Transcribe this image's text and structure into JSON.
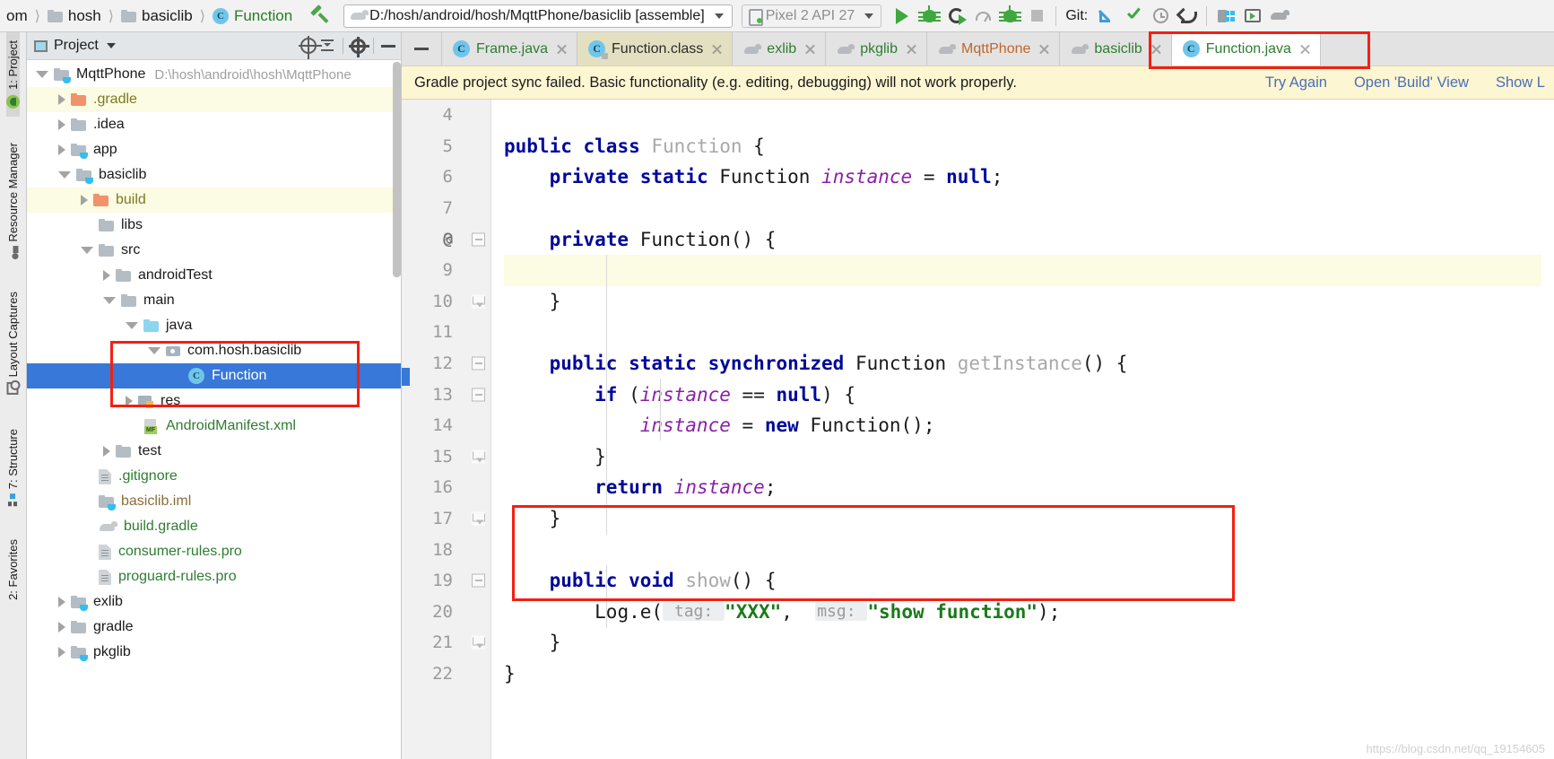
{
  "toolbar": {
    "breadcrumbs": [
      {
        "label": "om",
        "icon": "none",
        "color": "dark"
      },
      {
        "label": "hosh",
        "icon": "folder-icon",
        "color": "dark"
      },
      {
        "label": "basiclib",
        "icon": "folder-icon",
        "color": "dark"
      },
      {
        "label": "Function",
        "icon": "class-icon",
        "color": "green"
      }
    ],
    "build_icon": "hammer-icon",
    "run_config": {
      "icon": "gradle-icon",
      "value": "D:/hosh/android/hosh/MqttPhone/basiclib [assemble]",
      "dropdown_icon": "chevron-down-icon"
    },
    "device": {
      "icon": "device-icon",
      "value": "Pixel 2 API 27",
      "dropdown_icon": "chevron-down-icon"
    },
    "actions": [
      {
        "name": "run-button",
        "icon": "play-icon"
      },
      {
        "name": "debug-button",
        "icon": "bug-icon"
      },
      {
        "name": "run-coverage-button",
        "icon": "coverage-icon"
      },
      {
        "name": "profile-button",
        "icon": "gauge-icon"
      },
      {
        "name": "attach-debugger-button",
        "icon": "attach-debugger-icon"
      },
      {
        "name": "stop-button",
        "icon": "stop-icon"
      }
    ],
    "git_label": "Git:",
    "git_actions": [
      {
        "name": "update-project-button",
        "icon": "update-arrow-icon"
      },
      {
        "name": "commit-button",
        "icon": "check-icon"
      },
      {
        "name": "history-button",
        "icon": "clock-icon"
      },
      {
        "name": "rollback-button",
        "icon": "revert-icon"
      }
    ],
    "right_actions": [
      {
        "name": "project-structure-button",
        "icon": "project-structure-icon"
      },
      {
        "name": "avd-manager-button",
        "icon": "avd-manager-icon"
      },
      {
        "name": "sdk-manager-button",
        "icon": "sdk-manager-icon"
      }
    ]
  },
  "left_strip": {
    "tabs": [
      {
        "label": "1: Project",
        "icon": "android-icon",
        "active": true
      },
      {
        "label": "Resource Manager",
        "icon": "resource-icon",
        "active": false
      },
      {
        "label": "Layout Captures",
        "icon": "capture-icon",
        "active": false
      },
      {
        "label": "7: Structure",
        "icon": "structure-icon",
        "active": false
      },
      {
        "label": "2: Favorites",
        "icon": "favorites-icon",
        "active": false
      }
    ]
  },
  "project_panel": {
    "title": "Project",
    "window_icon": "project-window-icon",
    "dropdown_icon": "chevron-down-icon",
    "actions": [
      {
        "name": "scroll-from-source-button",
        "icon": "target-icon"
      },
      {
        "name": "collapse-all-button",
        "icon": "collapse-all-icon"
      },
      {
        "name": "settings-button",
        "icon": "gear-icon"
      },
      {
        "name": "hide-button",
        "icon": "minimize-icon"
      }
    ],
    "tree": [
      {
        "label": "MqttPhone",
        "hint": "D:\\hosh\\android\\hosh\\MqttPhone",
        "indent": 0,
        "arrow": "down",
        "icon": "module-folder-icon",
        "color": "dark",
        "state": "normal"
      },
      {
        "label": ".gradle",
        "hint": "",
        "indent": 1,
        "arrow": "right",
        "icon": "orange-folder-icon",
        "color": "olive",
        "state": "yellow"
      },
      {
        "label": ".idea",
        "hint": "",
        "indent": 1,
        "arrow": "right",
        "icon": "grey-folder-icon",
        "color": "dark",
        "state": "normal"
      },
      {
        "label": "app",
        "hint": "",
        "indent": 1,
        "arrow": "right",
        "icon": "module-folder-icon",
        "color": "dark",
        "state": "normal"
      },
      {
        "label": "basiclib",
        "hint": "",
        "indent": 1,
        "arrow": "down",
        "icon": "module-folder-icon",
        "color": "dark",
        "state": "normal"
      },
      {
        "label": "build",
        "hint": "",
        "indent": 2,
        "arrow": "right",
        "icon": "orange-folder-icon",
        "color": "olive",
        "state": "yellow"
      },
      {
        "label": "libs",
        "hint": "",
        "indent": 2,
        "arrow": "none",
        "icon": "grey-folder-icon",
        "color": "dark",
        "state": "normal"
      },
      {
        "label": "src",
        "hint": "",
        "indent": 2,
        "arrow": "down",
        "icon": "grey-folder-icon",
        "color": "dark",
        "state": "normal"
      },
      {
        "label": "androidTest",
        "hint": "",
        "indent": 3,
        "arrow": "right",
        "icon": "grey-folder-icon",
        "color": "dark",
        "state": "normal"
      },
      {
        "label": "main",
        "hint": "",
        "indent": 3,
        "arrow": "down",
        "icon": "grey-folder-icon",
        "color": "dark",
        "state": "normal"
      },
      {
        "label": "java",
        "hint": "",
        "indent": 4,
        "arrow": "down",
        "icon": "blue-folder-icon",
        "color": "dark",
        "state": "normal"
      },
      {
        "label": "com.hosh.basiclib",
        "hint": "",
        "indent": 5,
        "arrow": "down",
        "icon": "package-icon",
        "color": "dark",
        "state": "normal"
      },
      {
        "label": "Function",
        "hint": "",
        "indent": 6,
        "arrow": "none",
        "icon": "class-icon",
        "color": "white",
        "state": "selected"
      },
      {
        "label": "res",
        "hint": "",
        "indent": 4,
        "arrow": "right",
        "icon": "res-folder-icon",
        "color": "dark",
        "state": "normal"
      },
      {
        "label": "AndroidManifest.xml",
        "hint": "",
        "indent": 4,
        "arrow": "none",
        "icon": "manifest-icon",
        "color": "green",
        "state": "normal"
      },
      {
        "label": "test",
        "hint": "",
        "indent": 3,
        "arrow": "right",
        "icon": "grey-folder-icon",
        "color": "dark",
        "state": "normal"
      },
      {
        "label": ".gitignore",
        "hint": "",
        "indent": 2,
        "arrow": "none",
        "icon": "file-icon",
        "color": "green",
        "state": "normal"
      },
      {
        "label": "basiclib.iml",
        "hint": "",
        "indent": 2,
        "arrow": "none",
        "icon": "module-folder-icon",
        "color": "brown",
        "state": "normal"
      },
      {
        "label": "build.gradle",
        "hint": "",
        "indent": 2,
        "arrow": "none",
        "icon": "gradle-file-icon",
        "color": "green",
        "state": "normal"
      },
      {
        "label": "consumer-rules.pro",
        "hint": "",
        "indent": 2,
        "arrow": "none",
        "icon": "file-icon",
        "color": "green",
        "state": "normal"
      },
      {
        "label": "proguard-rules.pro",
        "hint": "",
        "indent": 2,
        "arrow": "none",
        "icon": "file-icon",
        "color": "green",
        "state": "normal"
      },
      {
        "label": "exlib",
        "hint": "",
        "indent": 1,
        "arrow": "right",
        "icon": "module-folder-icon",
        "color": "dark",
        "state": "normal"
      },
      {
        "label": "gradle",
        "hint": "",
        "indent": 1,
        "arrow": "right",
        "icon": "grey-folder-icon",
        "color": "dark",
        "state": "normal"
      },
      {
        "label": "pkglib",
        "hint": "",
        "indent": 1,
        "arrow": "right",
        "icon": "module-folder-icon",
        "color": "dark",
        "state": "normal"
      }
    ]
  },
  "editor": {
    "hide_button_icon": "minimize-icon",
    "tabs": [
      {
        "label": "Frame.java",
        "icon": "class-icon",
        "color": "green",
        "state": "normal",
        "close_icon": "close-icon"
      },
      {
        "label": "Function.class",
        "icon": "class-locked-icon",
        "color": "dark",
        "state": "selected-class",
        "close_icon": "close-icon"
      },
      {
        "label": "exlib",
        "icon": "gradle-icon",
        "color": "green",
        "state": "normal",
        "close_icon": "close-icon"
      },
      {
        "label": "pkglib",
        "icon": "gradle-icon",
        "color": "green",
        "state": "normal",
        "close_icon": "close-icon"
      },
      {
        "label": "MqttPhone",
        "icon": "gradle-icon",
        "color": "orange",
        "state": "normal",
        "close_icon": "close-icon"
      },
      {
        "label": "basiclib",
        "icon": "gradle-icon",
        "color": "green",
        "state": "normal",
        "close_icon": "close-icon"
      },
      {
        "label": "Function.java",
        "icon": "class-icon",
        "color": "green",
        "state": "active",
        "close_icon": "close-icon"
      }
    ],
    "banner": {
      "message": "Gradle project sync failed. Basic functionality (e.g. editing, debugging) will not work properly.",
      "links": [
        "Try Again",
        "Open 'Build' View",
        "Show L"
      ]
    },
    "lines": [
      {
        "num": "4",
        "at": false,
        "fold": "",
        "caret": false,
        "tokens": []
      },
      {
        "num": "5",
        "at": false,
        "fold": "",
        "caret": false,
        "tokens": [
          {
            "t": "public ",
            "c": "kw"
          },
          {
            "t": "class ",
            "c": "kw"
          },
          {
            "t": "Function ",
            "c": "cls"
          },
          {
            "t": "{",
            "c": "plain"
          }
        ]
      },
      {
        "num": "6",
        "at": false,
        "fold": "",
        "caret": false,
        "tokens": [
          {
            "t": "    ",
            "c": "plain"
          },
          {
            "t": "private ",
            "c": "kw"
          },
          {
            "t": "static ",
            "c": "kw"
          },
          {
            "t": "Function ",
            "c": "plain"
          },
          {
            "t": "instance",
            "c": "fld"
          },
          {
            "t": " = ",
            "c": "plain"
          },
          {
            "t": "null",
            "c": "kw"
          },
          {
            "t": ";",
            "c": "plain"
          }
        ]
      },
      {
        "num": "7",
        "at": false,
        "fold": "",
        "caret": false,
        "tokens": []
      },
      {
        "num": "8",
        "at": true,
        "fold": "minus",
        "caret": false,
        "tokens": [
          {
            "t": "    ",
            "c": "plain"
          },
          {
            "t": "private ",
            "c": "kw"
          },
          {
            "t": "Function() {",
            "c": "plain"
          }
        ]
      },
      {
        "num": "9",
        "at": false,
        "fold": "",
        "caret": true,
        "tokens": []
      },
      {
        "num": "10",
        "at": false,
        "fold": "tail",
        "caret": false,
        "tokens": [
          {
            "t": "    }",
            "c": "plain"
          }
        ]
      },
      {
        "num": "11",
        "at": false,
        "fold": "",
        "caret": false,
        "tokens": []
      },
      {
        "num": "12",
        "at": false,
        "fold": "minus",
        "caret": false,
        "tokens": [
          {
            "t": "    ",
            "c": "plain"
          },
          {
            "t": "public ",
            "c": "kw"
          },
          {
            "t": "static ",
            "c": "kw"
          },
          {
            "t": "synchronized ",
            "c": "kw"
          },
          {
            "t": "Function ",
            "c": "plain"
          },
          {
            "t": "getInstance",
            "c": "cls"
          },
          {
            "t": "() {",
            "c": "plain"
          }
        ]
      },
      {
        "num": "13",
        "at": false,
        "fold": "minus",
        "caret": false,
        "tokens": [
          {
            "t": "        ",
            "c": "plain"
          },
          {
            "t": "if ",
            "c": "kw"
          },
          {
            "t": "(",
            "c": "plain"
          },
          {
            "t": "instance",
            "c": "fld"
          },
          {
            "t": " == ",
            "c": "plain"
          },
          {
            "t": "null",
            "c": "kw"
          },
          {
            "t": ") {",
            "c": "plain"
          }
        ]
      },
      {
        "num": "14",
        "at": false,
        "fold": "",
        "caret": false,
        "tokens": [
          {
            "t": "            ",
            "c": "plain"
          },
          {
            "t": "instance",
            "c": "fld"
          },
          {
            "t": " = ",
            "c": "plain"
          },
          {
            "t": "new ",
            "c": "kw"
          },
          {
            "t": "Function();",
            "c": "plain"
          }
        ]
      },
      {
        "num": "15",
        "at": false,
        "fold": "tail",
        "caret": false,
        "tokens": [
          {
            "t": "        }",
            "c": "plain"
          }
        ]
      },
      {
        "num": "16",
        "at": false,
        "fold": "",
        "caret": false,
        "tokens": [
          {
            "t": "        ",
            "c": "plain"
          },
          {
            "t": "return ",
            "c": "kw"
          },
          {
            "t": "instance",
            "c": "fld"
          },
          {
            "t": ";",
            "c": "plain"
          }
        ]
      },
      {
        "num": "17",
        "at": false,
        "fold": "tail",
        "caret": false,
        "tokens": [
          {
            "t": "    }",
            "c": "plain"
          }
        ]
      },
      {
        "num": "18",
        "at": false,
        "fold": "",
        "caret": false,
        "tokens": []
      },
      {
        "num": "19",
        "at": false,
        "fold": "minus",
        "caret": false,
        "tokens": [
          {
            "t": "    ",
            "c": "plain"
          },
          {
            "t": "public ",
            "c": "kw"
          },
          {
            "t": "void ",
            "c": "kw"
          },
          {
            "t": "show",
            "c": "cls"
          },
          {
            "t": "() {",
            "c": "plain"
          }
        ]
      },
      {
        "num": "20",
        "at": false,
        "fold": "",
        "caret": false,
        "tokens": [
          {
            "t": "        ",
            "c": "plain"
          },
          {
            "t": "Log.e(",
            "c": "plain"
          },
          {
            "t": " tag: ",
            "c": "hint"
          },
          {
            "t": "\"XXX\"",
            "c": "str"
          },
          {
            "t": ",  ",
            "c": "plain"
          },
          {
            "t": "msg: ",
            "c": "hint"
          },
          {
            "t": "\"show function\"",
            "c": "str"
          },
          {
            "t": ");",
            "c": "plain"
          }
        ]
      },
      {
        "num": "21",
        "at": false,
        "fold": "tail",
        "caret": false,
        "tokens": [
          {
            "t": "    }",
            "c": "plain"
          }
        ]
      },
      {
        "num": "22",
        "at": false,
        "fold": "",
        "caret": false,
        "tokens": [
          {
            "t": "}",
            "c": "plain"
          }
        ]
      }
    ],
    "watermark": "https://blog.csdn.net/qq_19154605"
  },
  "annotations": {
    "accent_color": "#f22013",
    "boxes": [
      {
        "name": "tree-function-highlight"
      },
      {
        "name": "active-tab-highlight"
      },
      {
        "name": "show-method-highlight"
      }
    ]
  }
}
